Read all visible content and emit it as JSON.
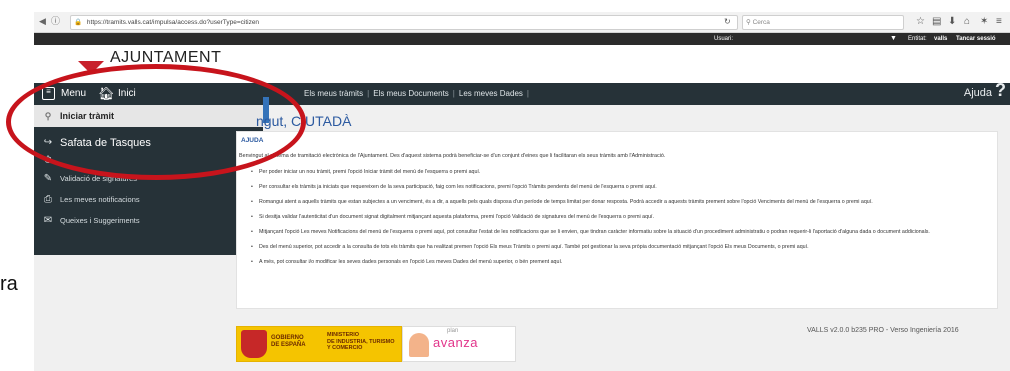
{
  "browser": {
    "url": "https://tramits.valls.cat/impulsa/access.do?userType=citizen",
    "search_placeholder": "Cerca",
    "icons": [
      "back-icon",
      "info-icon",
      "lock-icon",
      "reload-icon",
      "star-icon",
      "clipboard-icon",
      "download-icon",
      "home-icon",
      "extensions-icon",
      "hamburger-menu-icon"
    ]
  },
  "user_strip": {
    "user_label": "Usuari:",
    "entity_label": "Entitat:",
    "entity_value": "valls",
    "logout": "Tancar sessió"
  },
  "header": {
    "logo_text": "AJUNTAMENT"
  },
  "menu": {
    "menu_label": "Menu",
    "home_label": "Inici",
    "top_links": [
      "Els meus tràmits",
      "Els meus Documents",
      "Les meves Dades"
    ],
    "help_label": "Ajuda",
    "help_icon": "?"
  },
  "sidebar": {
    "items": [
      {
        "label": "Iniciar tràmit",
        "icon": "start-procedure-icon"
      },
      {
        "label": "Safata de Tasques",
        "icon": "task-tray-icon"
      },
      {
        "label": "",
        "icon": "clock-icon"
      },
      {
        "label": "Validació de signatures",
        "icon": "signature-icon"
      },
      {
        "label": "Les meves notificacions",
        "icon": "inbox-icon"
      },
      {
        "label": "Queixes i Suggeriments",
        "icon": "envelope-icon"
      }
    ]
  },
  "content": {
    "welcome_title": "ngut, CIUTADÀ",
    "section_heading": "AJUDA",
    "intro": "Benvingut al sistema de tramitació electrònica de l'Ajuntament. Des d'aquest sistema podrà beneficiar-se d'un conjunt d'eines que li facilitaran els seus tràmits amb l'Administració.",
    "bullets": [
      "Per poder iniciar un nou tràmit, premi l'opció Iniciar tràmit del menú de l'esquerra o premi aquí.",
      "Per consultar els tràmits ja iniciats que requereixen de la seva participació, faig com les notificacions, premi l'opció Tràmits pendents del menú de l'esquerra o premi aquí.",
      "Romangui atent a aquells tràmits que estan subjectes a un venciment, és a dir, a aquells pels quals disposa d'un període de temps limitat per donar resposta. Podrà accedir a aquests tràmits prement sobre l'opció Venciments del menú de l'esquerra o premi aquí.",
      "Si desitja validar l'autenticitat d'un document signat digitalment mitjançant aquesta plataforma, premi l'opció Validació de signatures del menú de l'esquerra o premi aquí.",
      "Mitjançant l'opció Les meves Notificacions del menú de l'esquerra o premi aquí, pot consultar l'estat de les notificacions que se li envien, que tindran caràcter informatiu sobre la situació d'un procediment administratiu o podran requerir-li l'aportació d'alguna dada o document addicionals.",
      "Des del menú superior, pot accedir a la consulta de tots els tràmits que ha realitzat premen l'opció Els meus Tràmits o premi aquí. També pot gestionar la seva pròpia documentació mitjançant l'opció Els meus Documents, o premi aquí.",
      "A més, pot consultar i/o modificar les seves dades personals en l'opció Les meves Dades del menú superior, o bén prement aquí."
    ]
  },
  "footer": {
    "gob_line1": "GOBIERNO",
    "gob_line2": "DE ESPAÑA",
    "min_line1": "MINISTERIO",
    "min_line2": "DE INDUSTRIA, TURISMO",
    "min_line3": "Y COMERCIO",
    "avanza_small": "plan",
    "avanza_word": "avanza",
    "version": "VALLS v2.0.0 b235 PRO - Verso Ingeniería 2016"
  },
  "stray_text": "ra",
  "colors": {
    "menu_bg": "#263238",
    "accent_blue": "#2c5aa0",
    "annotation_red": "#c7141c",
    "logo_red": "#c8202b"
  }
}
